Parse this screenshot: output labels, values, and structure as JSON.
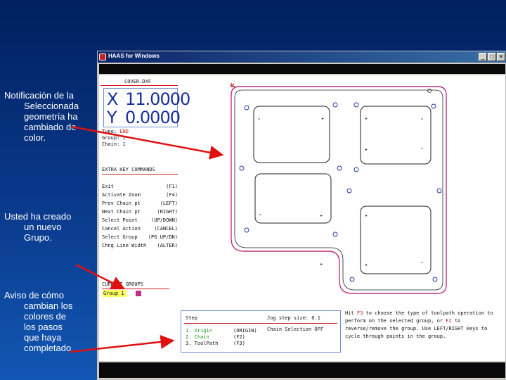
{
  "annotations": {
    "note1": [
      "Notificación de la",
      "Seleccionada",
      "geometría ha",
      "cambiado de",
      "color."
    ],
    "note2": [
      "Usted ha creado",
      "un nuevo",
      "Grupo."
    ],
    "note3": [
      "Aviso de cómo",
      "cambian los",
      "colores de",
      "los pasos",
      "que haya",
      "completado"
    ]
  },
  "window": {
    "title": "HAAS for Windows",
    "min_glyph": "_",
    "max_glyph": "□",
    "close_glyph": "✕"
  },
  "panel": {
    "filename": "COVER.DXF",
    "x_label": "X",
    "x_value": "11.0000",
    "y_label": "Y",
    "y_value": "0.0000",
    "type_label": "Type:",
    "type_value": "END",
    "group_label": "Group:",
    "group_value": "1",
    "chain_label": "Chain:",
    "chain_value": "1",
    "extra_title": "EXTRA KEY COMMANDS",
    "commands": [
      {
        "label": "Exit",
        "key": "(F1)"
      },
      {
        "label": "Activate Zoom",
        "key": "(F4)"
      },
      {
        "label": "Prev Chain pt",
        "key": "(LEFT)"
      },
      {
        "label": "Next Chain pt",
        "key": "(RIGHT)"
      },
      {
        "label": "Select Point",
        "key": "(UP/DOWN)"
      },
      {
        "label": "Cancel Action",
        "key": "(CANCEL)"
      },
      {
        "label": "Select Group",
        "key": "(PG UP/DN)"
      },
      {
        "label": "Chng Line Width",
        "key": "(ALTER)"
      }
    ],
    "groups_title": "CURRENT GROUPS",
    "group_item": "Group 1"
  },
  "steps": {
    "header": "Step",
    "jog_label": "Jog step size: 0.1",
    "chain_selection": "Chain Selection OFF",
    "items": [
      {
        "label": "1. Origin",
        "key": "(ORIGIN)"
      },
      {
        "label": "2. Chain",
        "key": "(F2)"
      },
      {
        "label": "3. ToolPath",
        "key": "(F3)"
      }
    ]
  },
  "help": {
    "p1": "Hit ",
    "k1": "F3",
    "p2": " to choose the type of toolpath operation to perform on the selected group, or ",
    "k2": "F2",
    "p3": " to reverse/remove the group. Use LEFT/RIGHT keys to cycle through points in the group."
  },
  "colors": {
    "accent_red": "#cc2020",
    "chain_magenta": "#c03080",
    "readout_blue": "#1a2ea0",
    "step_done_green": "#1b9a1b",
    "group_highlight": "#ffff60"
  }
}
